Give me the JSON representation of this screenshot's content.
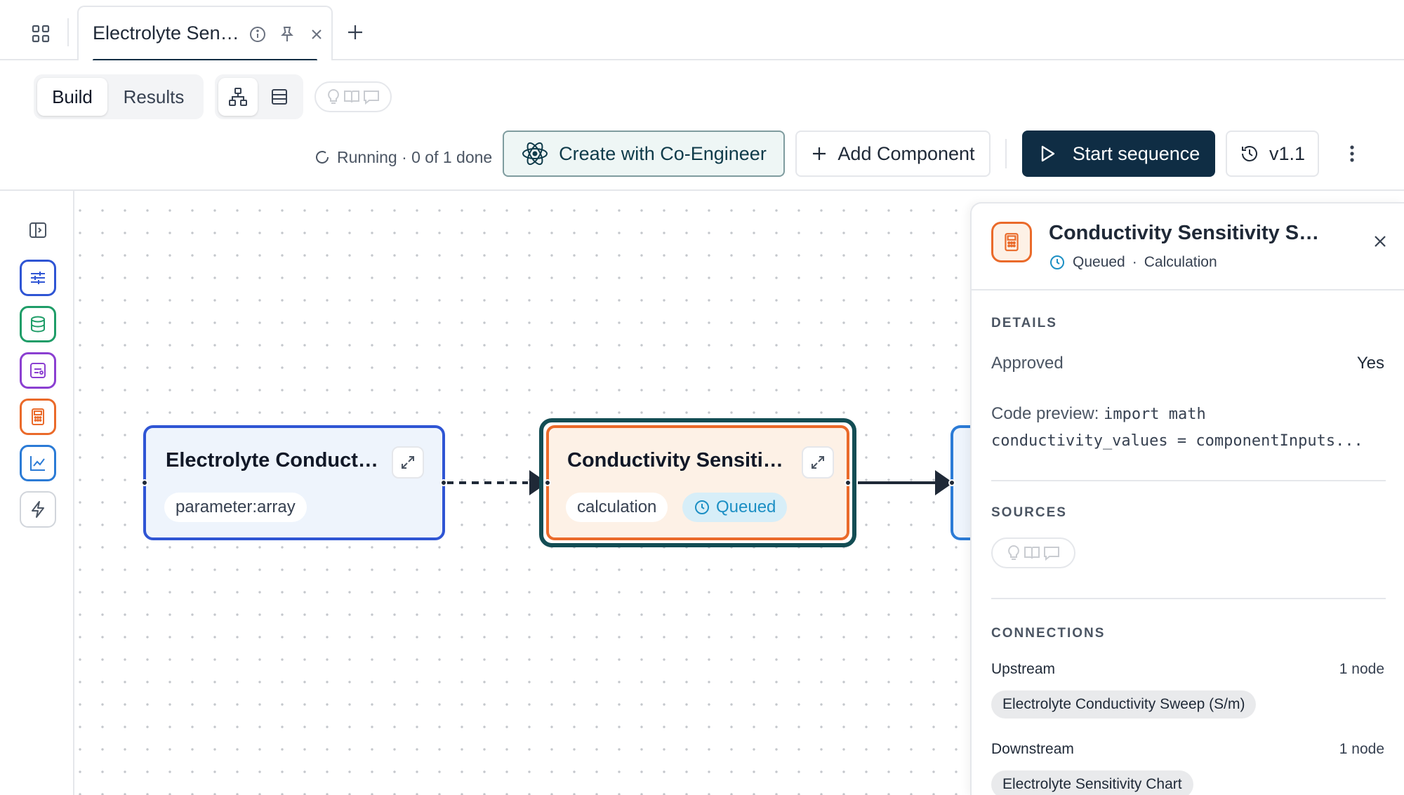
{
  "tabbar": {
    "tab_title": "Electrolyte Sen…",
    "add_tab": "+"
  },
  "toolbar": {
    "mode_build": "Build",
    "mode_results": "Results",
    "status": "Running · 0 of 1 done",
    "coengineer_label": "Create with Co-Engineer",
    "add_component_label": "Add Component",
    "start_label": "Start sequence",
    "version_label": "v1.1"
  },
  "rail": {
    "tools": [
      {
        "name": "parameter",
        "color": "#2f55d4"
      },
      {
        "name": "data",
        "color": "#1f9d68"
      },
      {
        "name": "model",
        "color": "#8b3fd1"
      },
      {
        "name": "calculation",
        "color": "#ea6a2a"
      },
      {
        "name": "chart",
        "color": "#2b7bd6"
      },
      {
        "name": "trigger",
        "color": "#6b7280"
      }
    ]
  },
  "canvas": {
    "nodes": [
      {
        "title": "Electrolyte Conduct…",
        "tag": "parameter:array",
        "color": "#2f55d4"
      },
      {
        "title": "Conductivity Sensiti…",
        "tag": "calculation",
        "status": "Queued",
        "color": "#ea6a2a"
      }
    ]
  },
  "panel": {
    "title": "Conductivity Sensitivity S…",
    "status": "Queued",
    "sep": "·",
    "type": "Calculation",
    "details_heading": "DETAILS",
    "approved_label": "Approved",
    "approved_value": "Yes",
    "code_label": "Code preview: ",
    "code_line1": "import math",
    "code_line2": "conductivity_values = componentInputs...",
    "sources_heading": "SOURCES",
    "connections_heading": "CONNECTIONS",
    "upstream_label": "Upstream",
    "upstream_count": "1 node",
    "upstream_item": "Electrolyte Conductivity Sweep (S/m)",
    "downstream_label": "Downstream",
    "downstream_count": "1 node",
    "downstream_item": "Electrolyte Sensitivity Chart"
  },
  "colors": {
    "primary_dark": "#0f2d44",
    "queued_blue": "#1c8fc4",
    "calc_orange": "#ea6a2a",
    "param_blue": "#2f55d4"
  }
}
